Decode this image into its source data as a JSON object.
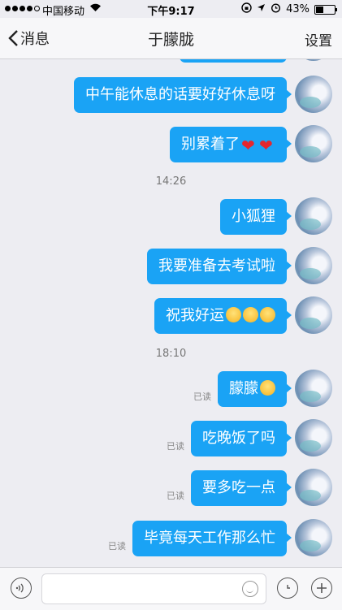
{
  "status_bar": {
    "carrier": "中国移动",
    "time": "下午9:17",
    "battery": "43%",
    "battery_level": 0.43
  },
  "nav": {
    "back_label": "消息",
    "title": "于朦胧",
    "settings_label": "设置"
  },
  "messages": [
    {
      "text": "中午能休息的话要好好休息呀",
      "emoji": [],
      "read": ""
    },
    {
      "text": "别累着了",
      "emoji": [
        "heart-emoji",
        "heart-emoji"
      ],
      "read": ""
    },
    {
      "timestamp": "14:26"
    },
    {
      "text": "小狐狸",
      "emoji": [],
      "read": ""
    },
    {
      "text": "我要准备去考试啦",
      "emoji": [],
      "read": ""
    },
    {
      "text": "祝我好运",
      "emoji": [
        "smile-emoji",
        "smile-emoji",
        "wink-emoji"
      ],
      "read": ""
    },
    {
      "timestamp": "18:10"
    },
    {
      "text": "朦朦",
      "emoji": [
        "kiss-emoji"
      ],
      "read": "已读"
    },
    {
      "text": "吃晚饭了吗",
      "emoji": [],
      "read": "已读"
    },
    {
      "text": "要多吃一点",
      "emoji": [],
      "read": "已读"
    },
    {
      "text": "毕竟每天工作那么忙",
      "emoji": [],
      "read": "已读"
    }
  ],
  "colors": {
    "bubble": "#1aa3f5",
    "background": "#ededf2"
  }
}
